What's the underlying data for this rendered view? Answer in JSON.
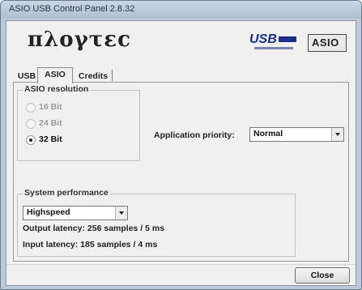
{
  "window": {
    "title": "ASIO USB Control Panel 2.8.32"
  },
  "brand": {
    "logo_text": "πλογτεc",
    "usb_logo": "USB",
    "asio_logo": "ASIO"
  },
  "tabs": [
    {
      "label": "USB",
      "active": false
    },
    {
      "label": "ASIO",
      "active": true
    },
    {
      "label": "Credits",
      "active": false
    }
  ],
  "asio_resolution": {
    "title": "ASIO resolution",
    "options": [
      {
        "label": "16 Bit",
        "enabled": false,
        "checked": false
      },
      {
        "label": "24 Bit",
        "enabled": false,
        "checked": false
      },
      {
        "label": "32 Bit",
        "enabled": true,
        "checked": true
      }
    ]
  },
  "application_priority": {
    "label": "Application priority:",
    "value": "Normal"
  },
  "system_performance": {
    "title": "System performance",
    "mode": "Highspeed",
    "output_latency": "Output latency: 256 samples / 5 ms",
    "input_latency": "Input latency: 185 samples / 4 ms"
  },
  "footer": {
    "close_label": "Close"
  }
}
